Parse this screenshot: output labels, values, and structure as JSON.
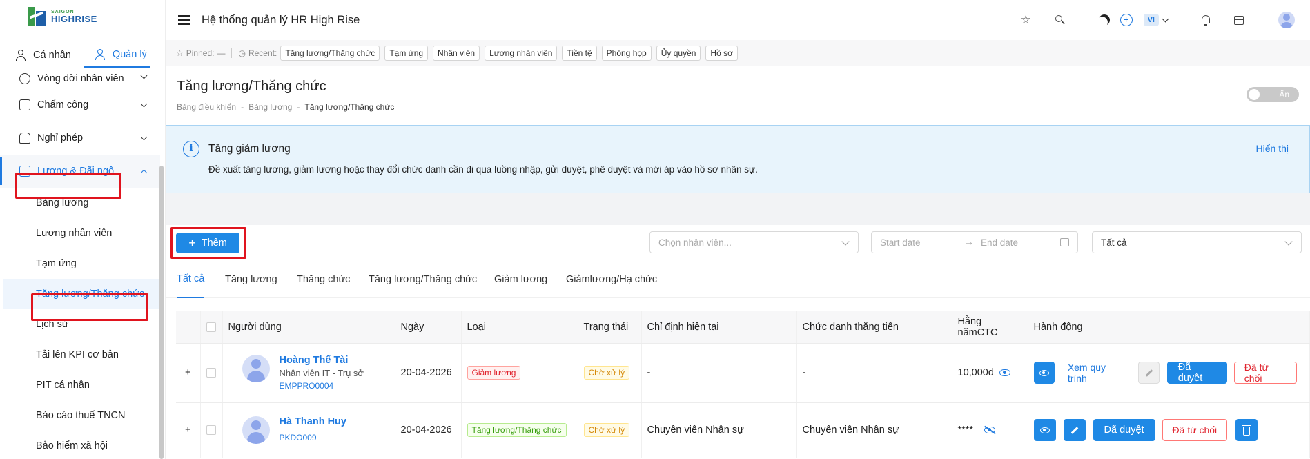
{
  "brand": {
    "line1": "SAIGON",
    "line2": "HIGHRISE"
  },
  "mode_tabs": [
    "Cá nhân",
    "Quản lý"
  ],
  "sidebar": {
    "items": [
      {
        "label": "Vòng đời nhân viên"
      },
      {
        "label": "Chấm công"
      },
      {
        "label": "Nghỉ phép"
      },
      {
        "label": "Lương & Đãi ngộ"
      }
    ],
    "sub_items": [
      "Bảng lương",
      "Lương nhân viên",
      "Tạm ứng",
      "Tăng lương/Thăng chức",
      "Lịch sử",
      "Tải lên KPI cơ bản",
      "PIT cá nhân",
      "Báo cáo thuế TNCN",
      "Bảo hiểm xã hội"
    ]
  },
  "header": {
    "title": "Hệ thống quản lý HR High Rise",
    "lang": "VI"
  },
  "recent_bar": {
    "pinned_label": "Pinned:",
    "pinned_value": "—",
    "recent_label": "Recent:",
    "chips": [
      "Tăng lương/Thăng chức",
      "Tạm ứng",
      "Nhân viên",
      "Lương nhân viên",
      "Tiền tệ",
      "Phòng họp",
      "Ủy quyền",
      "Hồ sơ"
    ]
  },
  "page": {
    "title": "Tăng lương/Thăng chức",
    "breadcrumb": [
      "Bảng điều khiển",
      "Bảng lương",
      "Tăng lương/Thăng chức"
    ],
    "toggle_label": "Ẩn"
  },
  "info": {
    "title": "Tăng giảm lương",
    "desc": "Đề xuất tăng lương, giảm lương hoặc thay đổi chức danh cần đi qua luồng nhập, gửi duyệt, phê duyệt và mới áp vào hồ sơ nhân sự.",
    "link": "Hiển thị"
  },
  "toolbar": {
    "add_label": "Thêm",
    "employee_placeholder": "Chọn nhân viên...",
    "start_placeholder": "Start date",
    "end_placeholder": "End date",
    "status_value": "Tất cả"
  },
  "tabs": [
    "Tất cả",
    "Tăng lương",
    "Thăng chức",
    "Tăng lương/Thăng chức",
    "Giảm lương",
    "Giảmlương/Hạ chức"
  ],
  "table": {
    "columns": [
      "Người dùng",
      "Ngày",
      "Loại",
      "Trạng thái",
      "Chỉ định hiện tại",
      "Chức danh thăng tiến",
      "Hằng nămCTC",
      "Hành động"
    ],
    "rows": [
      {
        "name": "Hoàng Thế Tài",
        "role": "Nhân viên IT - Trụ sở",
        "code": "EMPPRO0004",
        "date": "20-04-2026",
        "type": "Giảm lương",
        "status": "Chờ xử lý",
        "current": "-",
        "promoted": "-",
        "ctc": "10,000đ",
        "view_flow": "Xem quy trình",
        "approve": "Đã duyệt",
        "reject": "Đã từ chối"
      },
      {
        "name": "Hà Thanh Huy",
        "code": "PKDO009",
        "date": "20-04-2026",
        "type": "Tăng lương/Thăng chức",
        "status": "Chờ xử lý",
        "current": "Chuyên viên Nhân sự",
        "promoted": "Chuyên viên Nhân sự",
        "ctc": "****",
        "approve": "Đã duyệt",
        "reject": "Đã từ chối"
      }
    ]
  },
  "colors": {
    "primary": "#1f89e5",
    "highlight": "#e0141e"
  }
}
